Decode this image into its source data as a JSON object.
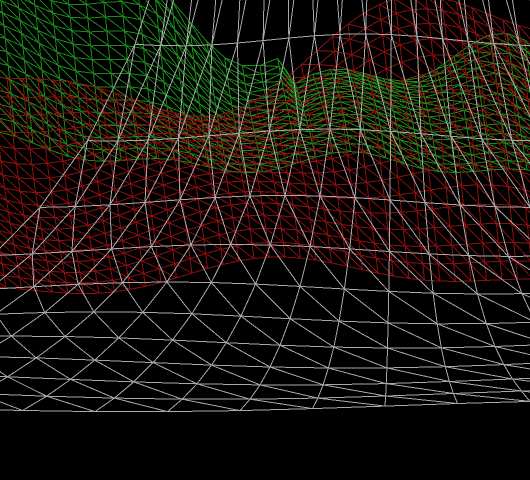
{
  "scene": {
    "background": "#000000",
    "layers": [
      {
        "id": "far-hills",
        "color": "#1a8a1a",
        "kind": "wireframe-terrain"
      },
      {
        "id": "mid-hills",
        "color": "#8b0f0f",
        "kind": "wireframe-terrain"
      },
      {
        "id": "ground",
        "color": "#a8a8a8",
        "kind": "wireframe-plane"
      }
    ]
  }
}
